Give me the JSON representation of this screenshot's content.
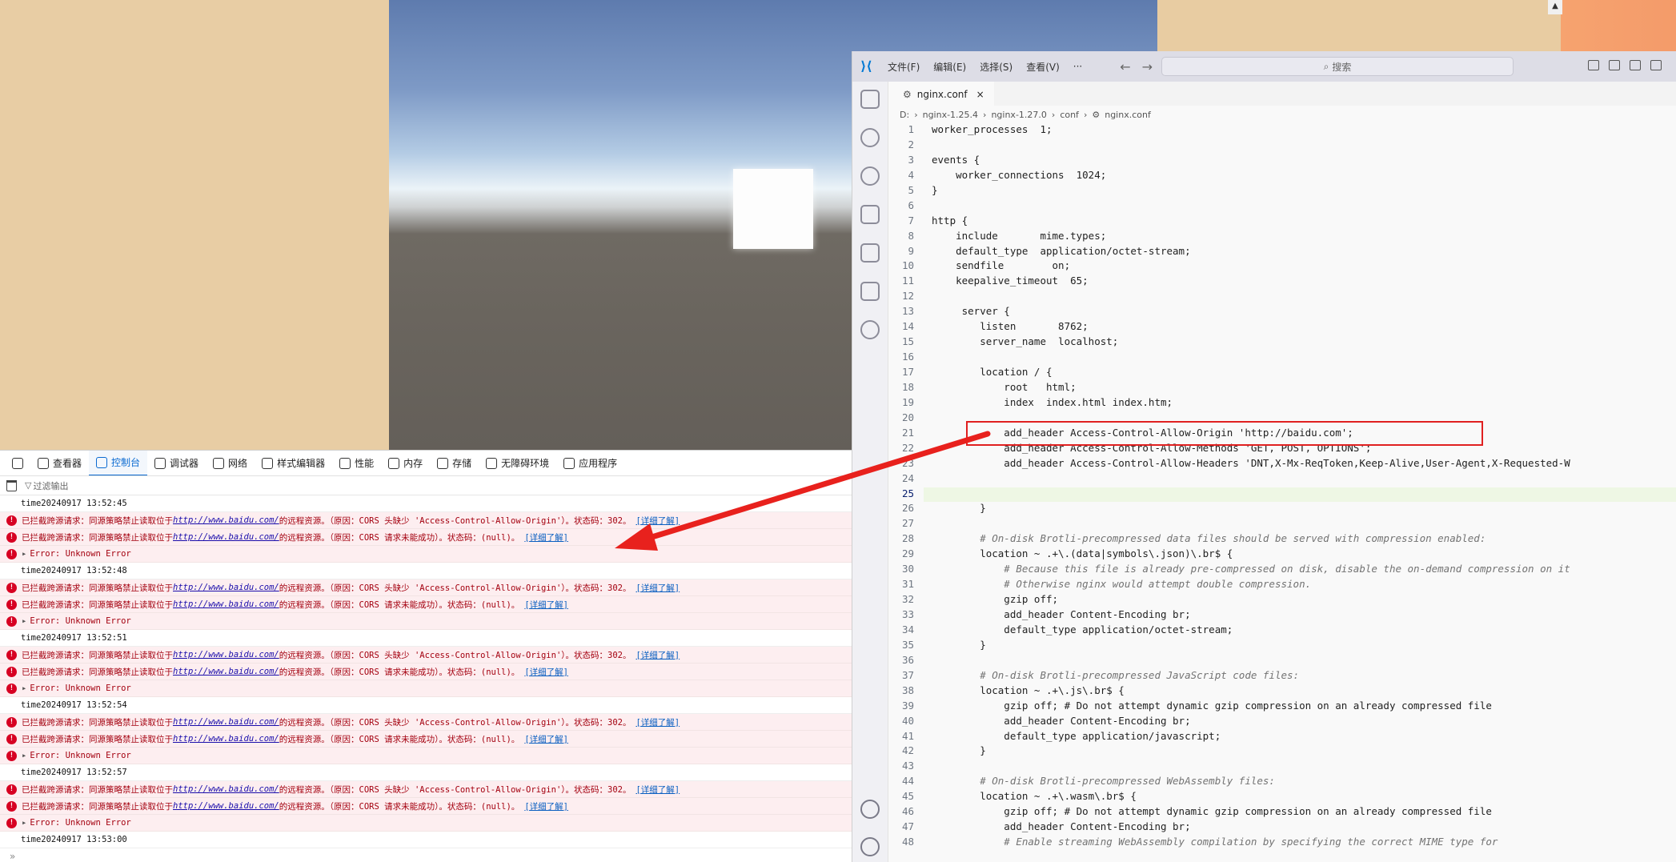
{
  "vscode": {
    "menu": [
      "文件(F)",
      "编辑(E)",
      "选择(S)",
      "查看(V)",
      "···"
    ],
    "nav_back": "←",
    "nav_forward": "→",
    "search_placeholder": "搜索",
    "tab_name": "nginx.conf",
    "tab_close": "×",
    "breadcrumb": [
      "D:",
      "nginx-1.25.4",
      "nginx-1.27.0",
      "conf",
      "nginx.conf"
    ],
    "active_line": 25,
    "lines": [
      "worker_processes  1;",
      "",
      "events {",
      "    worker_connections  1024;",
      "}",
      "",
      "http {",
      "    include       mime.types;",
      "    default_type  application/octet-stream;",
      "    sendfile        on;",
      "    keepalive_timeout  65;",
      "",
      "     server {",
      "        listen       8762;",
      "        server_name  localhost;",
      "",
      "        location / {",
      "            root   html;",
      "            index  index.html index.htm;",
      "",
      "            add_header Access-Control-Allow-Origin 'http://baidu.com';",
      "            add_header Access-Control-Allow-Methods 'GET, POST, OPTIONS';",
      "            add_header Access-Control-Allow-Headers 'DNT,X-Mx-ReqToken,Keep-Alive,User-Agent,X-Requested-W",
      "",
      "",
      "        }",
      "",
      "        # On-disk Brotli-precompressed data files should be served with compression enabled:",
      "        location ~ .+\\.(data|symbols\\.json)\\.br$ {",
      "            # Because this file is already pre-compressed on disk, disable the on-demand compression on it",
      "            # Otherwise nginx would attempt double compression.",
      "            gzip off;",
      "            add_header Content-Encoding br;",
      "            default_type application/octet-stream;",
      "        }",
      "",
      "        # On-disk Brotli-precompressed JavaScript code files:",
      "        location ~ .+\\.js\\.br$ {",
      "            gzip off; # Do not attempt dynamic gzip compression on an already compressed file",
      "            add_header Content-Encoding br;",
      "            default_type application/javascript;",
      "        }",
      "",
      "        # On-disk Brotli-precompressed WebAssembly files:",
      "        location ~ .+\\.wasm\\.br$ {",
      "            gzip off; # Do not attempt dynamic gzip compression on an already compressed file",
      "            add_header Content-Encoding br;",
      "            # Enable streaming WebAssembly compilation by specifying the correct MIME type for"
    ]
  },
  "devtools": {
    "tabs": [
      "查看器",
      "控制台",
      "调试器",
      "网络",
      "样式编辑器",
      "性能",
      "内存",
      "存储",
      "无障碍环境",
      "应用程序"
    ],
    "active_tab": "控制台",
    "filter_placeholder": "过滤输出",
    "prompt": "»",
    "err1_pre": "已拦截跨源请求：同源策略禁止读取位于 ",
    "err_url": "http://www.baidu.com/",
    "err1_post": " 的远程资源。（原因：CORS 头缺少 'Access-Control-Allow-Origin'）。状态码：302。",
    "err2_pre": "已拦截跨源请求：同源策略禁止读取位于 ",
    "err2_post": " 的远程资源。（原因：CORS 请求未能成功）。状态码：(null)。",
    "learn_more": "[详细了解]",
    "unknown_error": "Error: Unknown Error",
    "timestamps": [
      "time20240917 13:52:45",
      "time20240917 13:52:48",
      "time20240917 13:52:51",
      "time20240917 13:52:54",
      "time20240917 13:52:57",
      "time20240917 13:53:00"
    ]
  },
  "colors": {
    "highlight_box": "#e02020",
    "arrow": "#e8211d",
    "error_text": "#a4000f",
    "error_bg": "#fdeef0",
    "devtools_accent": "#0a6ad1"
  }
}
